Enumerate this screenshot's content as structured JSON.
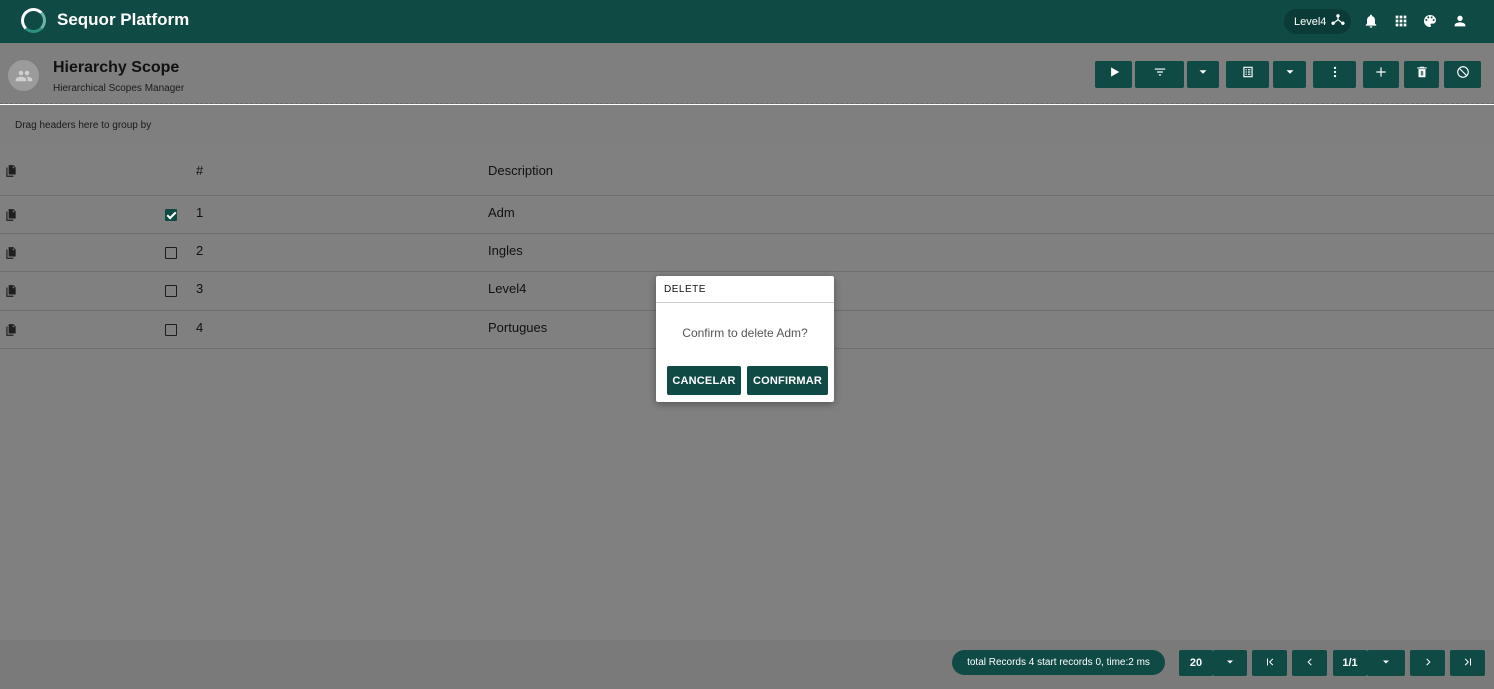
{
  "app": {
    "title": "Sequor Platform"
  },
  "topbar": {
    "level_label": "Level4",
    "icons": [
      "hierarchy-icon",
      "bell-icon",
      "apps-grid-icon",
      "palette-icon",
      "user-icon"
    ]
  },
  "page": {
    "title": "Hierarchy Scope",
    "subtitle": "Hierarchical Scopes Manager"
  },
  "toolbar": {
    "buttons": [
      "play-button",
      "filter-button",
      "filter-dropdown-button",
      "layout-button",
      "layout-dropdown-button",
      "more-options-button",
      "add-button",
      "delete-button",
      "cancel-button"
    ]
  },
  "grid": {
    "group_panel_text": "Drag headers here to group by",
    "columns": {
      "number": "#",
      "description": "Description"
    },
    "rows": [
      {
        "number": "1",
        "description": "Adm",
        "checked": true
      },
      {
        "number": "2",
        "description": "Ingles",
        "checked": false
      },
      {
        "number": "3",
        "description": "Level4",
        "checked": false
      },
      {
        "number": "4",
        "description": "Portugues",
        "checked": false
      }
    ]
  },
  "footer": {
    "records_text": "total Records 4 start records 0, time:2 ms",
    "page_size": "20",
    "page_indicator": "1/1"
  },
  "dialog": {
    "title": "DELETE",
    "message": "Confirm to delete Adm?",
    "cancel_label": "CANCELAR",
    "confirm_label": "CONFIRMAR"
  },
  "colors": {
    "primary": "#0f4a45",
    "overlay": "#808080",
    "white": "#ffffff"
  }
}
